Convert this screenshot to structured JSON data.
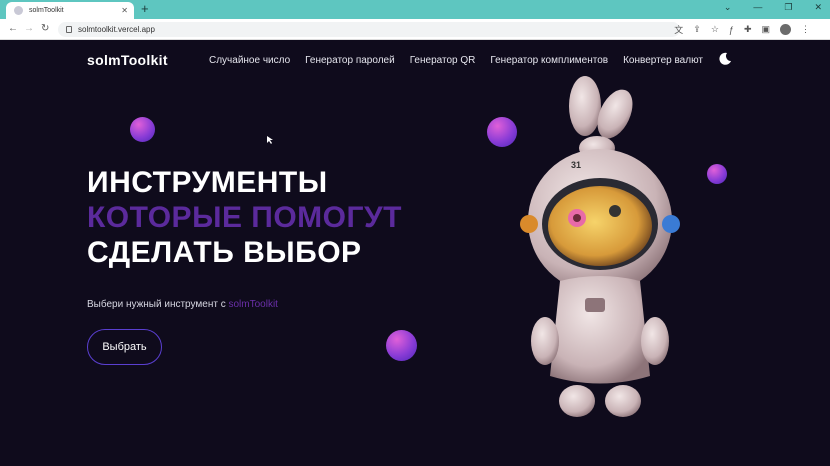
{
  "browser": {
    "tab_title": "solmToolkit",
    "tab_close": "✕",
    "new_tab": "+",
    "url": "solmtoolkit.vercel.app",
    "win_controls": [
      "⌄",
      "—",
      "❐",
      "✕"
    ],
    "back": "←",
    "forward": "→",
    "reload": "↻",
    "extension_icons": [
      "translate-icon",
      "share-icon",
      "star-icon",
      "font-icon",
      "puzzle-icon",
      "sidepanel-icon",
      "profile-avatar",
      "menu-icon"
    ],
    "extension_glyphs": [
      "文",
      "⇪",
      "☆",
      "ƒ",
      "✚",
      "▣",
      "",
      "⋮"
    ]
  },
  "site": {
    "logo": "solmToolkit",
    "nav": [
      "Случайное число",
      "Генератор паролей",
      "Генератор QR",
      "Генератор комплиментов",
      "Конвертер валют"
    ],
    "theme_toggle_icon": "moon-icon"
  },
  "hero": {
    "line1": "ИНСТРУМЕНТЫ",
    "line2": "КОТОРЫЕ ПОМОГУТ",
    "line3": "СДЕЛАТЬ ВЫБОР",
    "subtitle_prefix": "Выбери нужный инструмент с ",
    "subtitle_brand": "solmToolkit",
    "cta_label": "Выбрать",
    "mascot_badge": "31"
  },
  "colors": {
    "background": "#0f0b1c",
    "accent_purple": "#5b2a9c",
    "button_border": "#5a3fd0",
    "browser_tabbar": "#5ec6c0"
  }
}
